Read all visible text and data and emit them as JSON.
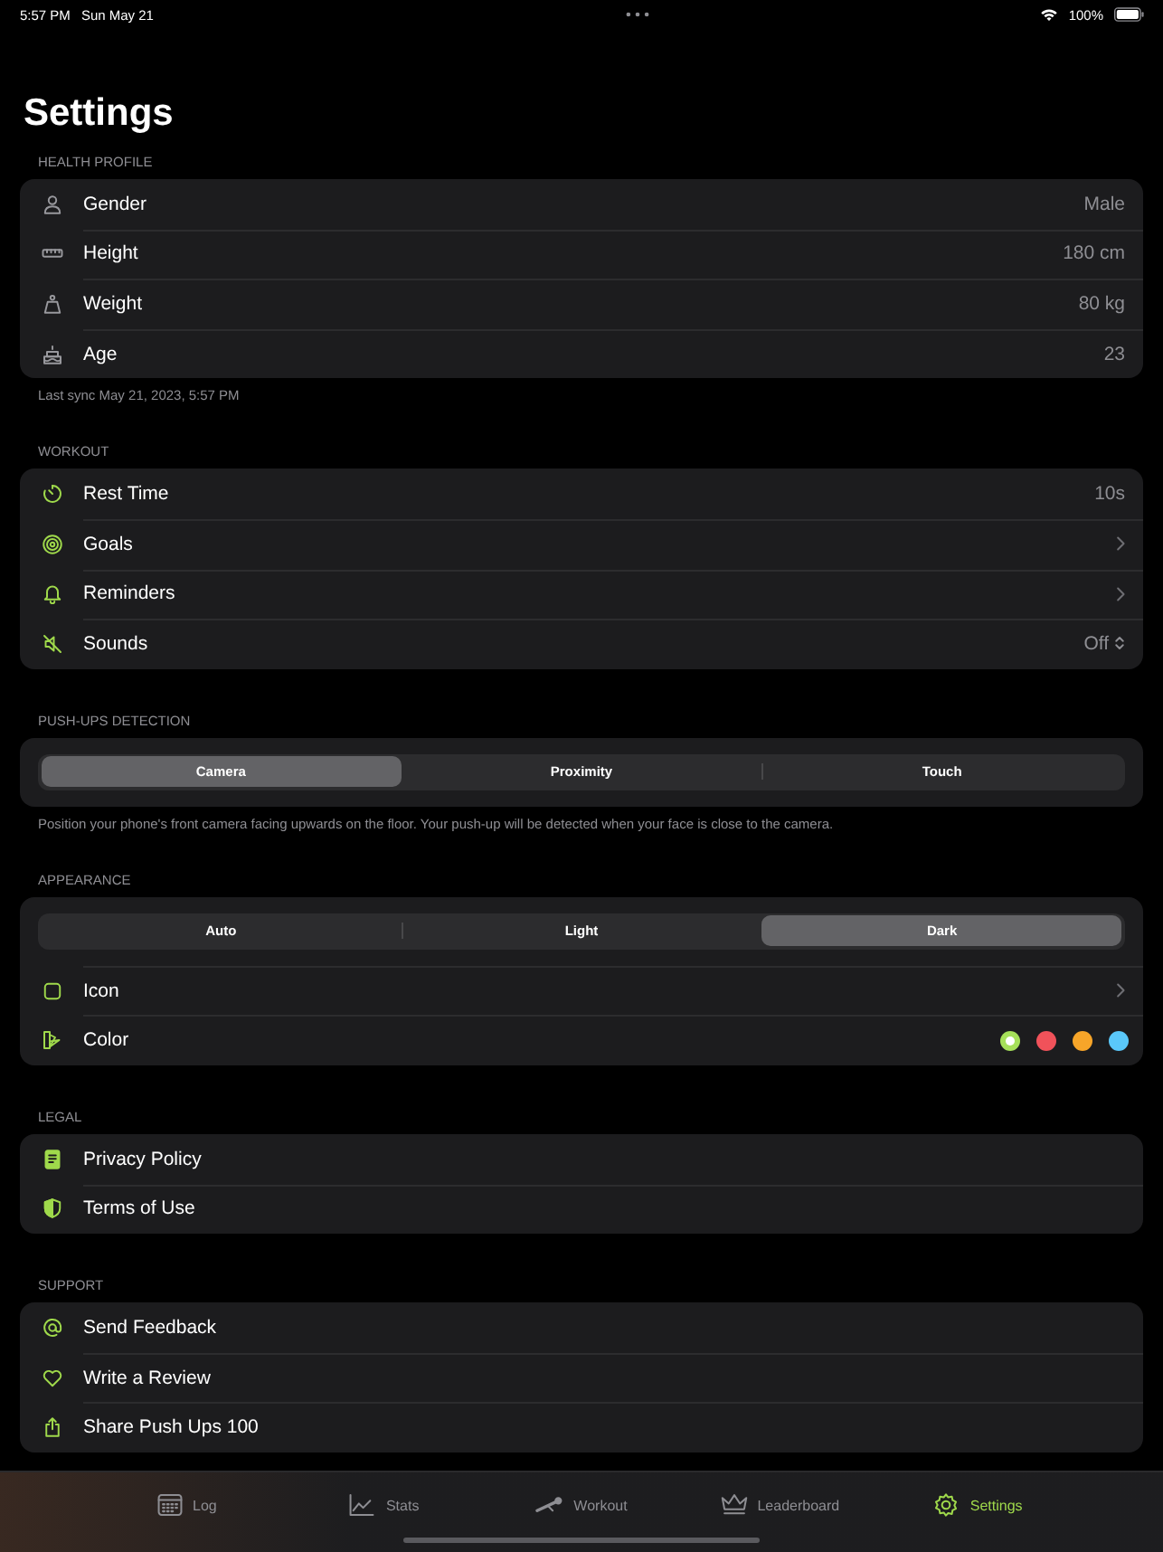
{
  "status_bar": {
    "time": "5:57 PM",
    "date": "Sun May 21",
    "battery": "100%"
  },
  "title": "Settings",
  "sections": [
    {
      "header": "HEALTH PROFILE",
      "footer": "Last sync May 21, 2023, 5:57 PM",
      "rows": [
        {
          "kind": "value",
          "label": "Gender",
          "value": "Male"
        },
        {
          "kind": "value",
          "label": "Height",
          "value": "180 cm"
        },
        {
          "kind": "value",
          "label": "Weight",
          "value": "80 kg"
        },
        {
          "kind": "value",
          "label": "Age",
          "value": "23"
        }
      ]
    },
    {
      "header": "WORKOUT",
      "rows": [
        {
          "kind": "value",
          "label": "Rest Time",
          "value": "10s"
        },
        {
          "kind": "chevron",
          "label": "Goals"
        },
        {
          "kind": "chevron",
          "label": "Reminders"
        },
        {
          "kind": "picker",
          "label": "Sounds",
          "value": "Off"
        }
      ]
    },
    {
      "header": "PUSH-UPS DETECTION",
      "footer": "Position your phone's front camera facing upwards on the floor. Your push-up will be detected when your face is close to the camera.",
      "rows": [
        {
          "kind": "segmented",
          "options": [
            {
              "label": "Camera",
              "selected": true
            },
            {
              "label": "Proximity",
              "selected": false
            },
            {
              "label": "Touch",
              "selected": false
            }
          ]
        }
      ]
    },
    {
      "header": "APPEARANCE",
      "rows": [
        {
          "kind": "segmented",
          "options": [
            {
              "label": "Auto",
              "selected": false
            },
            {
              "label": "Light",
              "selected": false
            },
            {
              "label": "Dark",
              "selected": true
            }
          ]
        },
        {
          "kind": "chevron",
          "label": "Icon"
        },
        {
          "kind": "colors",
          "label": "Color",
          "swatches": [
            {
              "color": "#a6e05a",
              "selected": true
            },
            {
              "color": "#f0525a",
              "selected": false
            },
            {
              "color": "#f7a529",
              "selected": false
            },
            {
              "color": "#5ac8fa",
              "selected": false
            }
          ]
        }
      ]
    },
    {
      "header": "LEGAL",
      "rows": [
        {
          "kind": "plain",
          "label": "Privacy Policy"
        },
        {
          "kind": "plain",
          "label": "Terms of Use"
        }
      ]
    },
    {
      "header": "SUPPORT",
      "rows": [
        {
          "kind": "plain",
          "label": "Send Feedback"
        },
        {
          "kind": "plain",
          "label": "Write a Review"
        },
        {
          "kind": "plain",
          "label": "Share Push Ups 100"
        }
      ]
    }
  ],
  "tabs": [
    {
      "label": "Log",
      "selected": false
    },
    {
      "label": "Stats",
      "selected": false
    },
    {
      "label": "Workout",
      "selected": false
    },
    {
      "label": "Leaderboard",
      "selected": false
    },
    {
      "label": "Settings",
      "selected": true
    }
  ]
}
